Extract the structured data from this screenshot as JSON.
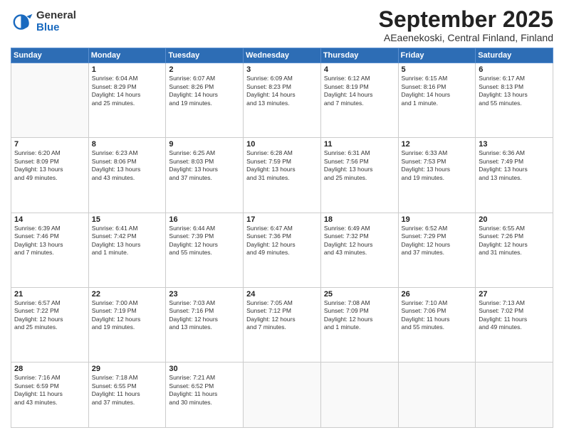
{
  "logo": {
    "general": "General",
    "blue": "Blue"
  },
  "title": "September 2025",
  "subtitle": "AEaenekoski, Central Finland, Finland",
  "days": [
    "Sunday",
    "Monday",
    "Tuesday",
    "Wednesday",
    "Thursday",
    "Friday",
    "Saturday"
  ],
  "weeks": [
    [
      {
        "day": "",
        "info": ""
      },
      {
        "day": "1",
        "info": "Sunrise: 6:04 AM\nSunset: 8:29 PM\nDaylight: 14 hours\nand 25 minutes."
      },
      {
        "day": "2",
        "info": "Sunrise: 6:07 AM\nSunset: 8:26 PM\nDaylight: 14 hours\nand 19 minutes."
      },
      {
        "day": "3",
        "info": "Sunrise: 6:09 AM\nSunset: 8:23 PM\nDaylight: 14 hours\nand 13 minutes."
      },
      {
        "day": "4",
        "info": "Sunrise: 6:12 AM\nSunset: 8:19 PM\nDaylight: 14 hours\nand 7 minutes."
      },
      {
        "day": "5",
        "info": "Sunrise: 6:15 AM\nSunset: 8:16 PM\nDaylight: 14 hours\nand 1 minute."
      },
      {
        "day": "6",
        "info": "Sunrise: 6:17 AM\nSunset: 8:13 PM\nDaylight: 13 hours\nand 55 minutes."
      }
    ],
    [
      {
        "day": "7",
        "info": "Sunrise: 6:20 AM\nSunset: 8:09 PM\nDaylight: 13 hours\nand 49 minutes."
      },
      {
        "day": "8",
        "info": "Sunrise: 6:23 AM\nSunset: 8:06 PM\nDaylight: 13 hours\nand 43 minutes."
      },
      {
        "day": "9",
        "info": "Sunrise: 6:25 AM\nSunset: 8:03 PM\nDaylight: 13 hours\nand 37 minutes."
      },
      {
        "day": "10",
        "info": "Sunrise: 6:28 AM\nSunset: 7:59 PM\nDaylight: 13 hours\nand 31 minutes."
      },
      {
        "day": "11",
        "info": "Sunrise: 6:31 AM\nSunset: 7:56 PM\nDaylight: 13 hours\nand 25 minutes."
      },
      {
        "day": "12",
        "info": "Sunrise: 6:33 AM\nSunset: 7:53 PM\nDaylight: 13 hours\nand 19 minutes."
      },
      {
        "day": "13",
        "info": "Sunrise: 6:36 AM\nSunset: 7:49 PM\nDaylight: 13 hours\nand 13 minutes."
      }
    ],
    [
      {
        "day": "14",
        "info": "Sunrise: 6:39 AM\nSunset: 7:46 PM\nDaylight: 13 hours\nand 7 minutes."
      },
      {
        "day": "15",
        "info": "Sunrise: 6:41 AM\nSunset: 7:42 PM\nDaylight: 13 hours\nand 1 minute."
      },
      {
        "day": "16",
        "info": "Sunrise: 6:44 AM\nSunset: 7:39 PM\nDaylight: 12 hours\nand 55 minutes."
      },
      {
        "day": "17",
        "info": "Sunrise: 6:47 AM\nSunset: 7:36 PM\nDaylight: 12 hours\nand 49 minutes."
      },
      {
        "day": "18",
        "info": "Sunrise: 6:49 AM\nSunset: 7:32 PM\nDaylight: 12 hours\nand 43 minutes."
      },
      {
        "day": "19",
        "info": "Sunrise: 6:52 AM\nSunset: 7:29 PM\nDaylight: 12 hours\nand 37 minutes."
      },
      {
        "day": "20",
        "info": "Sunrise: 6:55 AM\nSunset: 7:26 PM\nDaylight: 12 hours\nand 31 minutes."
      }
    ],
    [
      {
        "day": "21",
        "info": "Sunrise: 6:57 AM\nSunset: 7:22 PM\nDaylight: 12 hours\nand 25 minutes."
      },
      {
        "day": "22",
        "info": "Sunrise: 7:00 AM\nSunset: 7:19 PM\nDaylight: 12 hours\nand 19 minutes."
      },
      {
        "day": "23",
        "info": "Sunrise: 7:03 AM\nSunset: 7:16 PM\nDaylight: 12 hours\nand 13 minutes."
      },
      {
        "day": "24",
        "info": "Sunrise: 7:05 AM\nSunset: 7:12 PM\nDaylight: 12 hours\nand 7 minutes."
      },
      {
        "day": "25",
        "info": "Sunrise: 7:08 AM\nSunset: 7:09 PM\nDaylight: 12 hours\nand 1 minute."
      },
      {
        "day": "26",
        "info": "Sunrise: 7:10 AM\nSunset: 7:06 PM\nDaylight: 11 hours\nand 55 minutes."
      },
      {
        "day": "27",
        "info": "Sunrise: 7:13 AM\nSunset: 7:02 PM\nDaylight: 11 hours\nand 49 minutes."
      }
    ],
    [
      {
        "day": "28",
        "info": "Sunrise: 7:16 AM\nSunset: 6:59 PM\nDaylight: 11 hours\nand 43 minutes."
      },
      {
        "day": "29",
        "info": "Sunrise: 7:18 AM\nSunset: 6:55 PM\nDaylight: 11 hours\nand 37 minutes."
      },
      {
        "day": "30",
        "info": "Sunrise: 7:21 AM\nSunset: 6:52 PM\nDaylight: 11 hours\nand 30 minutes."
      },
      {
        "day": "",
        "info": ""
      },
      {
        "day": "",
        "info": ""
      },
      {
        "day": "",
        "info": ""
      },
      {
        "day": "",
        "info": ""
      }
    ]
  ]
}
